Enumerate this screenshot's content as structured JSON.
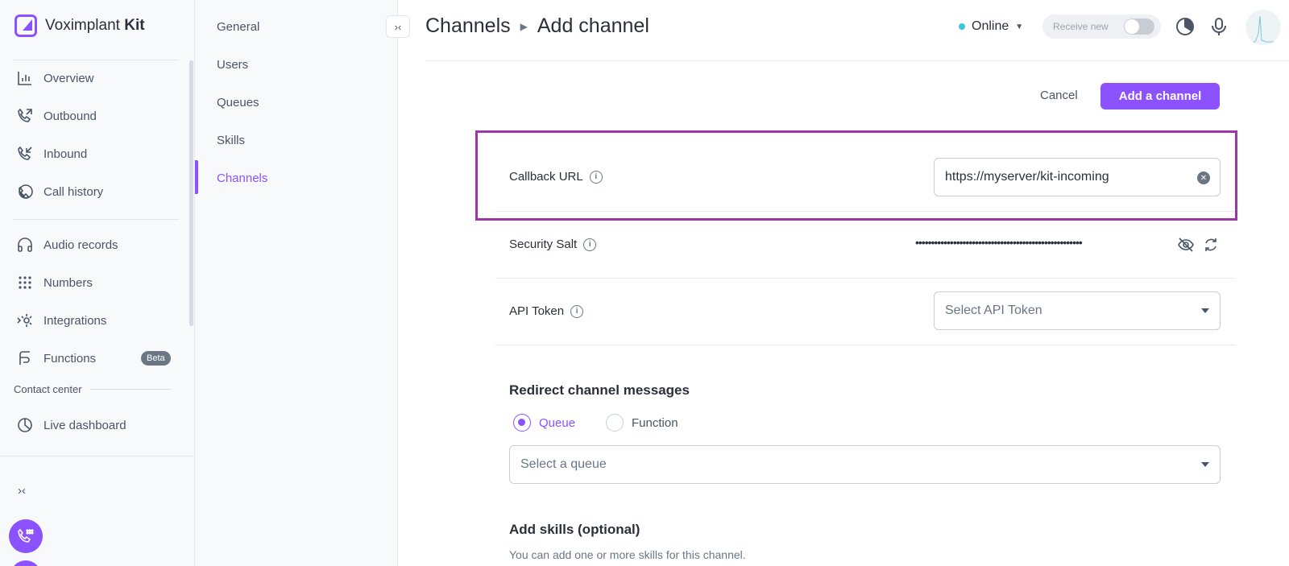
{
  "brand": {
    "name": "Voximplant",
    "suffix": "Kit"
  },
  "sidebar": {
    "items": [
      {
        "label": "Overview",
        "icon": "overview-chart-icon"
      },
      {
        "label": "Outbound",
        "icon": "outbound-call-icon"
      },
      {
        "label": "Inbound",
        "icon": "inbound-call-icon"
      },
      {
        "label": "Call history",
        "icon": "call-history-icon"
      },
      {
        "label": "Audio records",
        "icon": "headphones-icon"
      },
      {
        "label": "Numbers",
        "icon": "dialpad-icon"
      },
      {
        "label": "Integrations",
        "icon": "integrations-icon"
      },
      {
        "label": "Functions",
        "icon": "functions-icon",
        "badge": "Beta"
      },
      {
        "label": "Live dashboard",
        "icon": "pie-chart-icon"
      }
    ],
    "section_label": "Contact center"
  },
  "subnav": {
    "items": [
      "General",
      "Users",
      "Queues",
      "Skills",
      "Channels"
    ],
    "active": "Channels"
  },
  "header": {
    "breadcrumb": [
      "Channels",
      "Add channel"
    ],
    "status": "Online",
    "receive_label": "Receive new"
  },
  "actions": {
    "cancel": "Cancel",
    "add": "Add a channel"
  },
  "form": {
    "callback_url": {
      "label": "Callback URL",
      "value": "https://myserver/kit-incoming"
    },
    "security_salt": {
      "label": "Security Salt",
      "masked": "•••••••••••••••••••••••••••••••••••••••••••••••••••••"
    },
    "api_token": {
      "label": "API Token",
      "placeholder": "Select API Token"
    },
    "redirect": {
      "title": "Redirect channel messages",
      "options": [
        "Queue",
        "Function"
      ],
      "selected": "Queue",
      "queue_placeholder": "Select a queue"
    },
    "skills": {
      "title": "Add skills (optional)",
      "helper": "You can add one or more skills for this channel."
    }
  },
  "colors": {
    "accent": "#8c52ff",
    "highlight": "#9b37a6",
    "online": "#3ec4e0"
  }
}
